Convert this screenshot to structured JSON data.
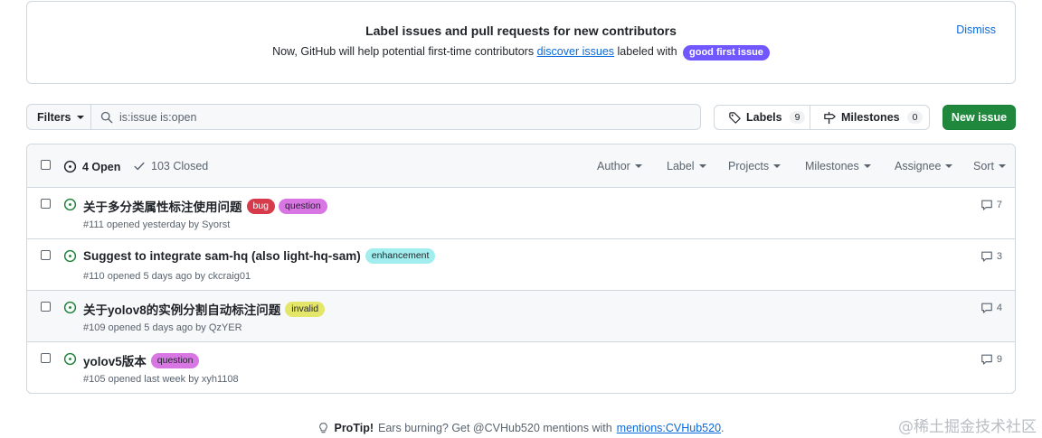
{
  "banner": {
    "title": "Label issues and pull requests for new contributors",
    "text_before": "Now, GitHub will help potential first-time contributors",
    "link": "discover issues",
    "text_after": "labeled with",
    "label": "good first issue",
    "dismiss": "Dismiss"
  },
  "toolbar": {
    "filters_label": "Filters",
    "search_value": "is:issue is:open",
    "labels_label": "Labels",
    "labels_count": "9",
    "milestones_label": "Milestones",
    "milestones_count": "0",
    "new_issue_label": "New issue"
  },
  "header": {
    "open": "4 Open",
    "closed": "103 Closed",
    "menus": [
      "Author",
      "Label",
      "Projects",
      "Milestones",
      "Assignee",
      "Sort"
    ]
  },
  "issues": [
    {
      "title": "关于多分类属性标注使用问题",
      "labels": [
        {
          "name": "bug",
          "bg": "#d73a4a",
          "fg": "#ffffff"
        },
        {
          "name": "question",
          "bg": "#d876e3",
          "fg": "#1f2328"
        }
      ],
      "meta": "#111 opened yesterday by Syorst",
      "comments": "7"
    },
    {
      "title": "Suggest to integrate sam-hq (also light-hq-sam)",
      "labels": [
        {
          "name": "enhancement",
          "bg": "#a2eeef",
          "fg": "#1f2328"
        }
      ],
      "meta": "#110 opened 5 days ago by ckcraig01",
      "comments": "3"
    },
    {
      "title": "关于yolov8的实例分割自动标注问题",
      "labels": [
        {
          "name": "invalid",
          "bg": "#e4e669",
          "fg": "#1f2328"
        }
      ],
      "meta": "#109 opened 5 days ago by QzYER",
      "comments": "4"
    },
    {
      "title": "yolov5版本",
      "labels": [
        {
          "name": "question",
          "bg": "#d876e3",
          "fg": "#1f2328"
        }
      ],
      "meta": "#105 opened last week by xyh1108",
      "comments": "9"
    }
  ],
  "footer": {
    "protip_label": "ProTip!",
    "protip_text": "Ears burning? Get @CVHub520 mentions with",
    "protip_link": "mentions:CVHub520",
    "protip_end": "."
  },
  "watermark": "@稀土掘金技术社区",
  "colors": {
    "open_green": "#1a7f37",
    "link_blue": "#0969da",
    "good_first_issue": "#7057ff"
  }
}
